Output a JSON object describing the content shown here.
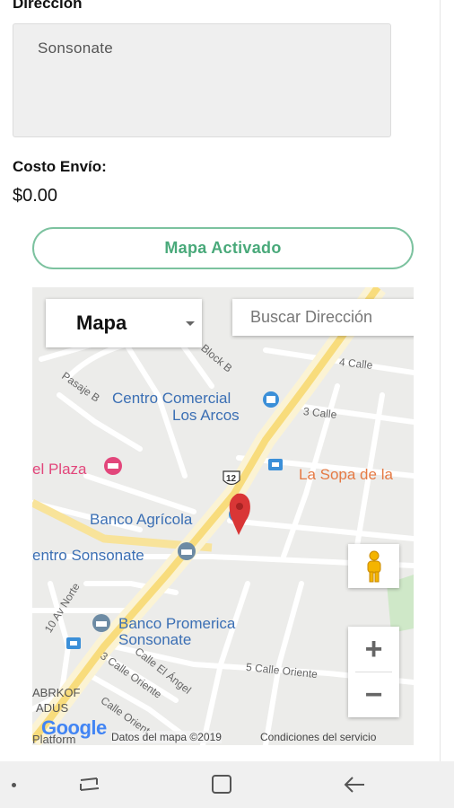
{
  "form": {
    "direccion_label": "Direccion",
    "direccion_value": "Sonsonate",
    "costo_label": "Costo Envío:",
    "costo_value": "$0.00",
    "map_button_label": "Mapa Activado"
  },
  "map": {
    "type_selector": "Mapa",
    "search_placeholder": "Buscar Dirección",
    "labels": {
      "centro_comercial": "Centro Comercial",
      "los_arcos": "Los Arcos",
      "el_plaza": "el Plaza",
      "la_sopa": "La Sopa de la",
      "banco_agricola": "Banco Agrícola",
      "centro_sonsonate": "entro Sonsonate",
      "banco_promerica": "Banco Promerica",
      "promerica_sonsonate": "Sonsonate",
      "block_b": "Block B",
      "pasaje_b": "Pasaje B",
      "calle_4": "4 Calle",
      "calle_3": "3 Calle",
      "route_12": "12",
      "av_norte": "10 Av Norte",
      "calle_el_angel": "Calle El Ángel",
      "calle_3_oriente": "3 Calle Oriente",
      "calle_5_oriente": "5 Calle Oriente",
      "abrkof": "ABRKOF",
      "adus": "ADUS",
      "platform": "Platform",
      "calle_oriente": "Calle Orient"
    },
    "google_logo": "Google",
    "attribution": "Datos del mapa ©2019",
    "terms": "Condiciones del servicio",
    "zoom_in": "+",
    "zoom_out": "−"
  },
  "colors": {
    "accent": "#49a97a",
    "marker": "#d93636",
    "poi_blue": "#3b6fb4",
    "poi_pink": "#e2467b",
    "poi_orange": "#e57a44",
    "main_road": "#f8dc7c"
  },
  "icons": {
    "pegman": "pegman-icon",
    "marker": "map-marker-icon",
    "nav_recents": "recents-icon",
    "nav_home": "home-icon",
    "nav_back": "back-icon"
  }
}
